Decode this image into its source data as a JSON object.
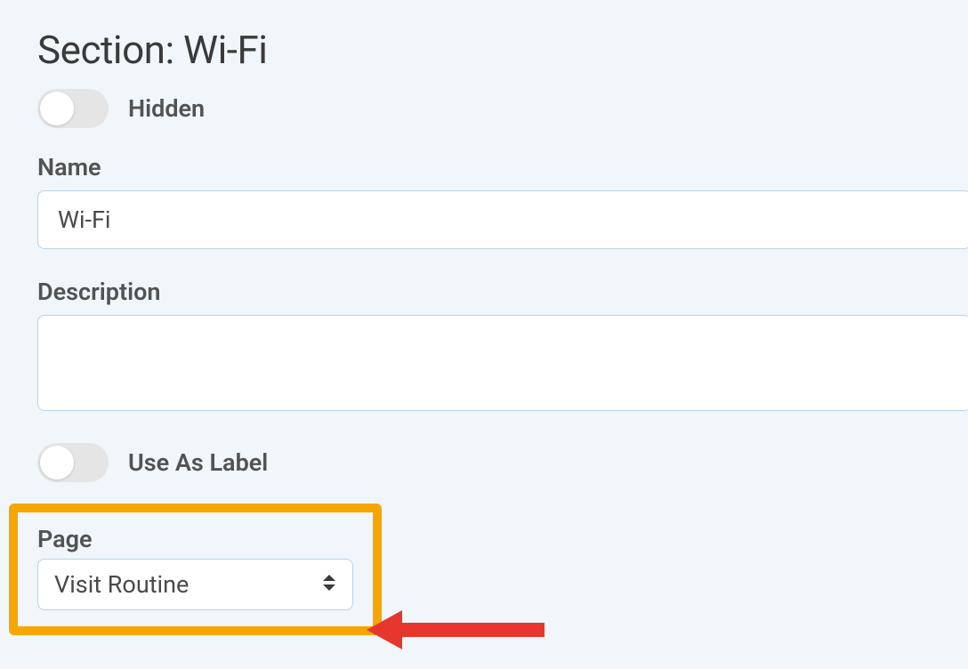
{
  "section": {
    "title": "Section: Wi-Fi"
  },
  "hidden_toggle": {
    "label": "Hidden"
  },
  "name_field": {
    "label": "Name",
    "value": "Wi-Fi"
  },
  "description_field": {
    "label": "Description",
    "value": ""
  },
  "use_as_label_toggle": {
    "label": "Use As Label"
  },
  "page_field": {
    "label": "Page",
    "value": "Visit Routine"
  }
}
